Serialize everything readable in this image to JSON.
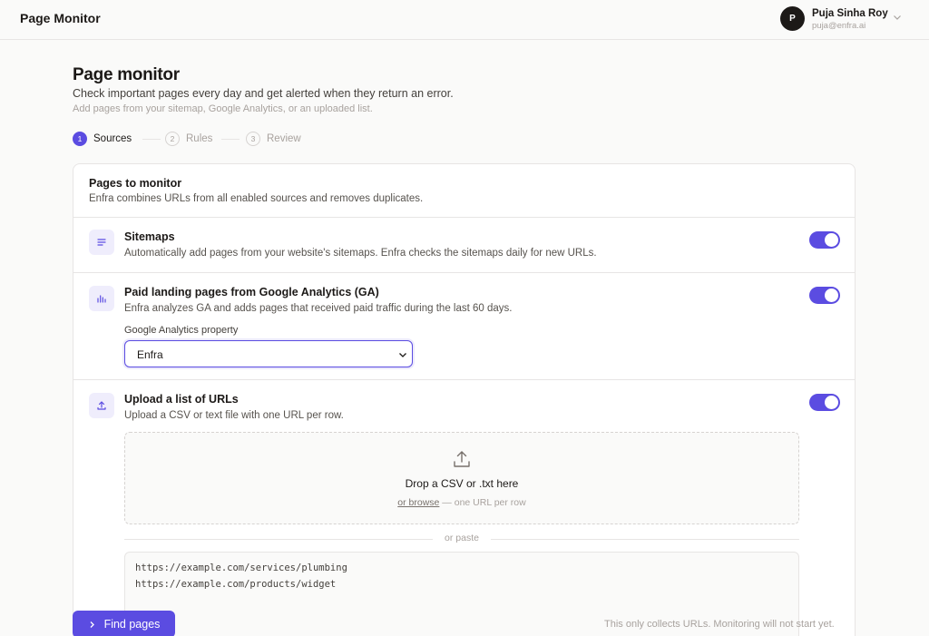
{
  "app": {
    "title": "Page Monitor"
  },
  "user": {
    "initial": "P",
    "name": "Puja Sinha Roy",
    "email": "puja@enfra.ai"
  },
  "header": {
    "title": "Page monitor",
    "subtitle": "Check important pages every day and get alerted when they return an error.",
    "hint": "Add pages from your sitemap, Google Analytics, or an uploaded list."
  },
  "stepper": {
    "steps": [
      {
        "number": "1",
        "label": "Sources",
        "state": "active"
      },
      {
        "number": "2",
        "label": "Rules",
        "state": "upcoming"
      },
      {
        "number": "3",
        "label": "Review",
        "state": "upcoming"
      }
    ]
  },
  "card": {
    "title": "Pages to monitor",
    "description": "Enfra combines URLs from all enabled sources and removes duplicates."
  },
  "sources": {
    "sitemaps": {
      "icon": "list-icon",
      "title": "Sitemaps",
      "description": "Automatically add pages from your website's sitemaps. Enfra checks the sitemaps daily for new URLs.",
      "enabled": true
    },
    "ga": {
      "icon": "bar-chart-icon",
      "title": "Paid landing pages from Google Analytics (GA)",
      "description": "Enfra analyzes GA and adds pages that received paid traffic during the last 60 days.",
      "enabled": true,
      "property_label": "Google Analytics property",
      "property_value": "Enfra"
    },
    "upload": {
      "icon": "upload-icon",
      "title": "Upload a list of URLs",
      "description": "Upload a CSV or text file with one URL per row.",
      "enabled": true,
      "drop_title": "Drop a CSV or .txt here",
      "browse_link": "or browse",
      "drop_hint": " — one URL per row",
      "or_paste": "or paste",
      "pasted_urls": [
        "https://example.com/services/plumbing",
        "https://example.com/products/widget"
      ]
    }
  },
  "footer": {
    "find_button": "Find pages",
    "note": "This only collects URLs. Monitoring will not start yet."
  },
  "colors": {
    "accent": "#5b4ce1",
    "icon_bg": "#efedfc"
  }
}
